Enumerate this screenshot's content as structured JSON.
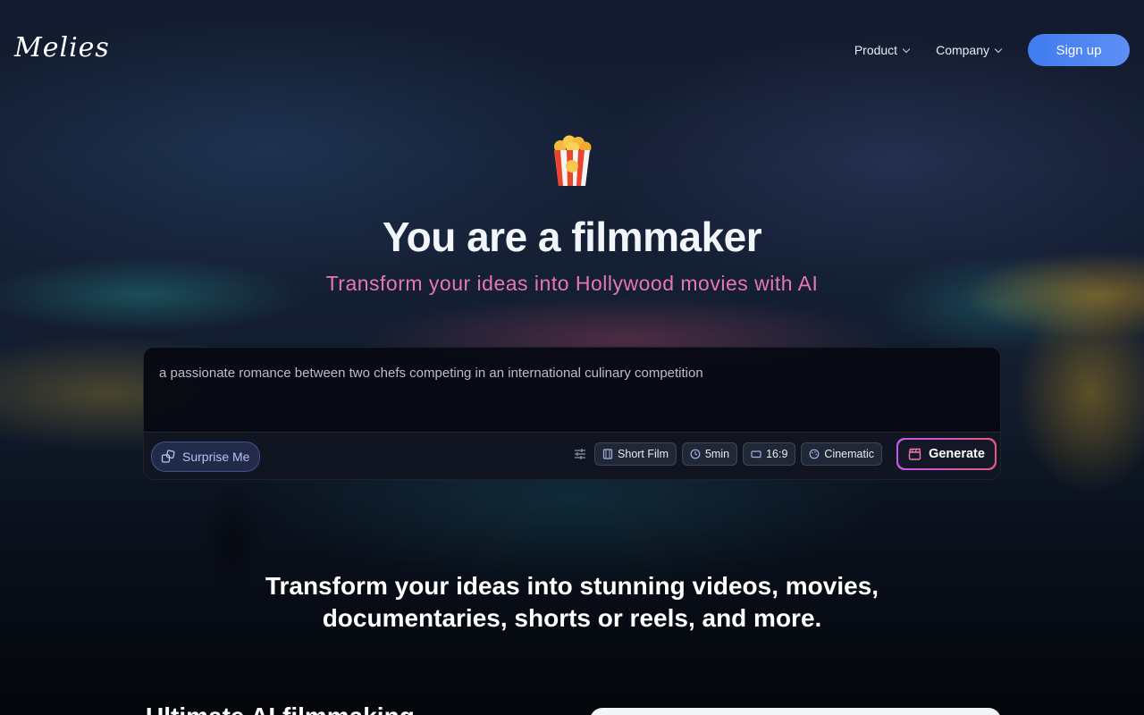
{
  "header": {
    "logo": "Melies",
    "nav": [
      {
        "label": "Product"
      },
      {
        "label": "Company"
      }
    ],
    "signup_label": "Sign up"
  },
  "hero": {
    "icon": "popcorn-icon",
    "title": "You are a filmmaker",
    "subtitle": "Transform your ideas into Hollywood movies with AI"
  },
  "prompt": {
    "value": "a passionate romance between two chefs competing in an international culinary competition",
    "surprise_label": "Surprise Me",
    "chips": [
      {
        "icon": "film-icon",
        "label": "Short Film"
      },
      {
        "icon": "clock-icon",
        "label": "5min"
      },
      {
        "icon": "aspect-ratio-icon",
        "label": "16:9"
      },
      {
        "icon": "palette-icon",
        "label": "Cinematic"
      }
    ],
    "generate_label": "Generate"
  },
  "tagline": {
    "line1": "Transform your ideas into stunning videos, movies,",
    "line2": "documentaries, shorts or reels, and more."
  },
  "section": {
    "heading_partial": "Ultimate AI filmmaking"
  },
  "colors": {
    "accent_blue": "#4f84f2",
    "subtitle_pink": "#e676b6",
    "generate_border_start": "#c05af0",
    "generate_border_end": "#e05a80"
  }
}
